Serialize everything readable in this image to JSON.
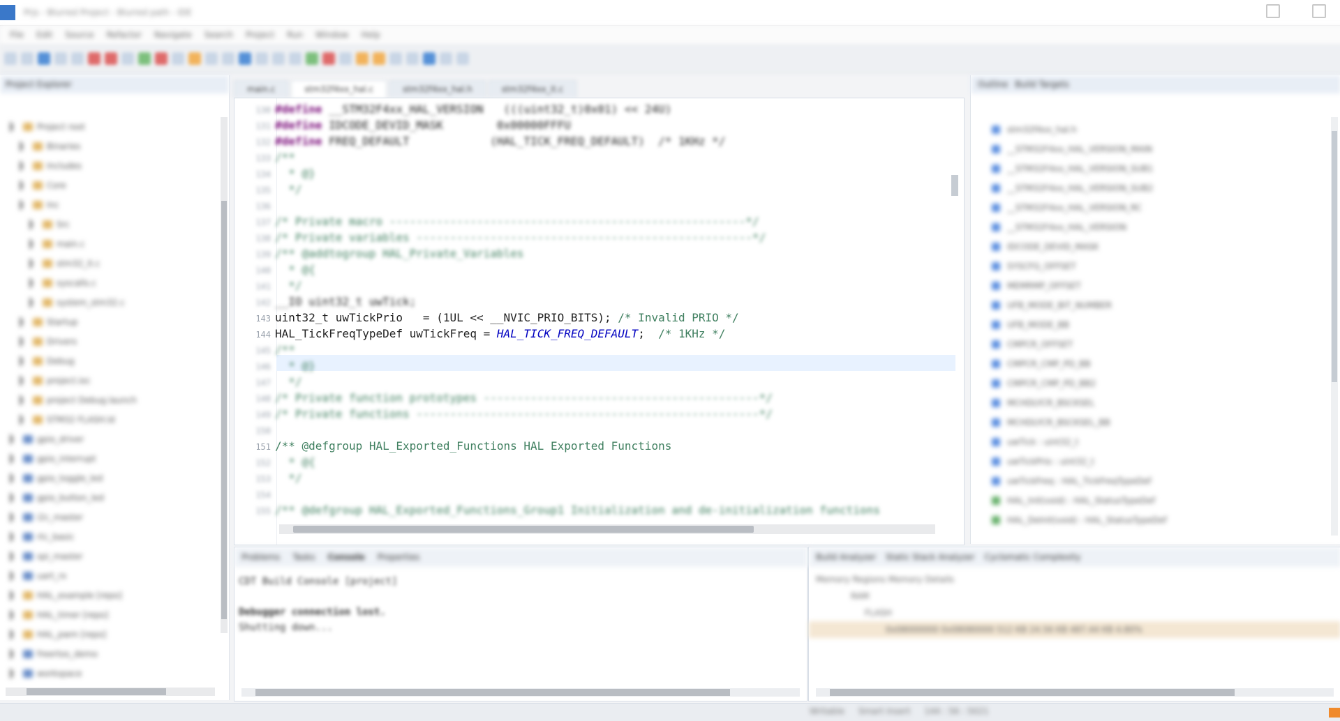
{
  "window": {
    "title": "Prjs - Blurred Project - Blurred path - IDE"
  },
  "menu": {
    "items": [
      "File",
      "Edit",
      "Source",
      "Refactor",
      "Navigate",
      "Search",
      "Project",
      "Run",
      "Window",
      "Help"
    ]
  },
  "left_panel": {
    "tab_label": "Project Explorer",
    "tree": [
      {
        "label": "Project root",
        "indent": 1,
        "icon": "folder"
      },
      {
        "label": "Binaries",
        "indent": 2,
        "icon": "folder"
      },
      {
        "label": "Includes",
        "indent": 2,
        "icon": "folder"
      },
      {
        "label": "Core",
        "indent": 2,
        "icon": "folder"
      },
      {
        "label": "Inc",
        "indent": 2,
        "icon": "folder"
      },
      {
        "label": "Src",
        "indent": 3,
        "icon": "file"
      },
      {
        "label": "main.c",
        "indent": 3,
        "icon": "file"
      },
      {
        "label": "stm32_it.c",
        "indent": 3,
        "icon": "file"
      },
      {
        "label": "syscalls.c",
        "indent": 3,
        "icon": "file"
      },
      {
        "label": "system_stm32.c",
        "indent": 3,
        "icon": "file"
      },
      {
        "label": "Startup",
        "indent": 2,
        "icon": "folder"
      },
      {
        "label": "Drivers",
        "indent": 2,
        "icon": "folder"
      },
      {
        "label": "Debug",
        "indent": 2,
        "icon": "folder"
      },
      {
        "label": "project.ioc",
        "indent": 2,
        "icon": "file"
      },
      {
        "label": "project Debug.launch",
        "indent": 2,
        "icon": "file"
      },
      {
        "label": "STM32 FLASH.ld",
        "indent": 2,
        "icon": "file"
      },
      {
        "label": "gpio_driver",
        "indent": 1,
        "icon": "folder-blue"
      },
      {
        "label": "gpio_interrupt",
        "indent": 1,
        "icon": "folder-blue"
      },
      {
        "label": "gpio_toggle_led",
        "indent": 1,
        "icon": "folder-blue"
      },
      {
        "label": "gpio_button_led",
        "indent": 1,
        "icon": "folder-blue"
      },
      {
        "label": "i2c_master",
        "indent": 1,
        "icon": "folder-blue"
      },
      {
        "label": "rtc_basic",
        "indent": 1,
        "icon": "folder-blue"
      },
      {
        "label": "spi_master",
        "indent": 1,
        "icon": "folder-blue"
      },
      {
        "label": "uart_rx",
        "indent": 1,
        "icon": "folder-blue"
      },
      {
        "label": "HAL_example [repo]",
        "indent": 1,
        "icon": "folder"
      },
      {
        "label": "HAL_timer [repo]",
        "indent": 1,
        "icon": "folder"
      },
      {
        "label": "HAL_pwm [repo]",
        "indent": 1,
        "icon": "folder"
      },
      {
        "label": "freertos_demo",
        "indent": 1,
        "icon": "folder-blue"
      },
      {
        "label": "workspace",
        "indent": 1,
        "icon": "folder-blue"
      }
    ]
  },
  "editor": {
    "tabs": [
      "main.c",
      "stm32f4xx_hal.c",
      "stm32f4xx_hal.h",
      "stm32f4xx_it.c"
    ],
    "active_tab": 1,
    "lines": [
      {
        "num": "130",
        "tokens": [
          {
            "t": "#define",
            "c": "kw"
          },
          {
            "t": " __STM32F4xx_HAL_VERSION   (((uint32_t)0x01) << 24U)",
            "c": "plain"
          }
        ]
      },
      {
        "num": "131",
        "tokens": [
          {
            "t": "#define",
            "c": "kw"
          },
          {
            "t": " IDCODE_DEVID_MASK        0x00000FFFU",
            "c": "plain"
          }
        ]
      },
      {
        "num": "132",
        "tokens": [
          {
            "t": "#define",
            "c": "kw"
          },
          {
            "t": " FREQ_DEFAULT            (HAL_TICK_FREQ_DEFAULT)  /* 1KHz */",
            "c": "plain"
          }
        ]
      },
      {
        "num": "133",
        "tokens": [
          {
            "t": "/**",
            "c": "cm"
          }
        ]
      },
      {
        "num": "134",
        "tokens": [
          {
            "t": "  * @}",
            "c": "cm"
          }
        ]
      },
      {
        "num": "135",
        "tokens": [
          {
            "t": "  */",
            "c": "cm"
          }
        ]
      },
      {
        "num": "136",
        "tokens": [
          {
            "t": "",
            "c": "plain"
          }
        ]
      },
      {
        "num": "137",
        "tokens": [
          {
            "t": "/* Private macro -----------------------------------------------------*/",
            "c": "cm"
          }
        ]
      },
      {
        "num": "138",
        "tokens": [
          {
            "t": "/* Private variables --------------------------------------------------*/",
            "c": "cm"
          }
        ]
      },
      {
        "num": "139",
        "tokens": [
          {
            "t": "/** @addtogroup HAL_Private_Variables",
            "c": "cm"
          }
        ]
      },
      {
        "num": "140",
        "tokens": [
          {
            "t": "  * @{",
            "c": "cm"
          }
        ]
      },
      {
        "num": "141",
        "tokens": [
          {
            "t": "  */",
            "c": "cm"
          }
        ]
      },
      {
        "num": "142",
        "tokens": [
          {
            "t": "__IO uint32_t uwTick;",
            "c": "plain"
          }
        ]
      },
      {
        "num": "143",
        "tokens": [
          {
            "t": "uint32_t uwTickPrio   = (1UL << __NVIC_PRIO_BITS); ",
            "c": "plain"
          },
          {
            "t": "/* Invalid PRIO */",
            "c": "cm"
          }
        ]
      },
      {
        "num": "144",
        "tokens": [
          {
            "t": "HAL_TickFreqTypeDef uwTickFreq = ",
            "c": "plain"
          },
          {
            "t": "HAL_TICK_FREQ_DEFAULT",
            "c": "it"
          },
          {
            "t": ";  ",
            "c": "plain"
          },
          {
            "t": "/* 1KHz */",
            "c": "cm"
          }
        ]
      },
      {
        "num": "145",
        "tokens": [
          {
            "t": "/**",
            "c": "cm"
          }
        ]
      },
      {
        "num": "146",
        "tokens": [
          {
            "t": "  * @}",
            "c": "cm"
          }
        ]
      },
      {
        "num": "147",
        "tokens": [
          {
            "t": "  */",
            "c": "cm"
          }
        ]
      },
      {
        "num": "148",
        "tokens": [
          {
            "t": "/* Private function prototypes -----------------------------------------*/",
            "c": "cm"
          }
        ]
      },
      {
        "num": "149",
        "tokens": [
          {
            "t": "/* Private functions ---------------------------------------------------*/",
            "c": "cm"
          }
        ]
      },
      {
        "num": "150",
        "tokens": [
          {
            "t": "",
            "c": "plain"
          }
        ]
      },
      {
        "num": "151",
        "tokens": [
          {
            "t": "/** @defgroup HAL_Exported_Functions HAL Exported Functions",
            "c": "cm"
          }
        ]
      },
      {
        "num": "152",
        "tokens": [
          {
            "t": "  * @{",
            "c": "cm"
          }
        ]
      },
      {
        "num": "153",
        "tokens": [
          {
            "t": "  */",
            "c": "cm"
          }
        ]
      },
      {
        "num": "154",
        "tokens": [
          {
            "t": "",
            "c": "plain"
          }
        ]
      },
      {
        "num": "155",
        "tokens": [
          {
            "t": "/** @defgroup HAL_Exported_Functions_Group1 Initialization and de-initialization functions",
            "c": "cm"
          }
        ]
      }
    ]
  },
  "right_panel": {
    "tab_label": "Outline",
    "tab2_label": "Build Targets",
    "items": [
      {
        "label": "stm32f4xx_hal.h",
        "icon": "blue"
      },
      {
        "label": "__STM32F4xx_HAL_VERSION_MAIN",
        "icon": "blue"
      },
      {
        "label": "__STM32F4xx_HAL_VERSION_SUB1",
        "icon": "blue"
      },
      {
        "label": "__STM32F4xx_HAL_VERSION_SUB2",
        "icon": "blue"
      },
      {
        "label": "__STM32F4xx_HAL_VERSION_RC",
        "icon": "blue"
      },
      {
        "label": "__STM32F4xx_HAL_VERSION",
        "icon": "blue"
      },
      {
        "label": "IDCODE_DEVID_MASK",
        "icon": "blue"
      },
      {
        "label": "SYSCFG_OFFSET",
        "icon": "blue"
      },
      {
        "label": "MEMRMP_OFFSET",
        "icon": "blue"
      },
      {
        "label": "UFB_MODE_BIT_NUMBER",
        "icon": "blue"
      },
      {
        "label": "UFB_MODE_BB",
        "icon": "blue"
      },
      {
        "label": "CMPCR_OFFSET",
        "icon": "blue"
      },
      {
        "label": "CMPCR_CMP_PD_BB",
        "icon": "blue"
      },
      {
        "label": "CMPCR_CMP_PD_BB2",
        "icon": "blue"
      },
      {
        "label": "MCHDLYCR_BSCKSEL",
        "icon": "blue"
      },
      {
        "label": "MCHDLYCR_BSCKSEL_BB",
        "icon": "blue"
      },
      {
        "label": "uwTick : uint32_t",
        "icon": "blue"
      },
      {
        "label": "uwTickPrio : uint32_t",
        "icon": "blue"
      },
      {
        "label": "uwTickFreq : HAL_TickFreqTypeDef",
        "icon": "blue"
      },
      {
        "label": "HAL_Init(void) : HAL_StatusTypeDef",
        "icon": "green"
      },
      {
        "label": "HAL_DeInit(void) : HAL_StatusTypeDef",
        "icon": "green"
      }
    ]
  },
  "bottom_left": {
    "tabs": [
      "Problems",
      "Tasks",
      "Console",
      "Properties"
    ],
    "active_tab": 2,
    "header_line": "CDT Build Console [project]",
    "lines": [
      "Debugger connection lost.",
      "Shutting down..."
    ]
  },
  "bottom_right": {
    "tabs": [
      "Build Analyzer",
      "Static Stack Analyzer",
      "Cyclomatic Complexity"
    ],
    "header_line": "Memory Regions  Memory Details",
    "lines": [
      "RAM",
      "FLASH",
      "0x08000000  0x08080000  512 KB  24.56 KB  487.44 KB  4.80%"
    ]
  },
  "status": {
    "items": [
      "Writable",
      "Smart Insert",
      "144 : 56 : 5021"
    ]
  },
  "colors": {
    "keyword": "#7a0b7a",
    "comment": "#3f7f5f",
    "italic_const": "#0000c0",
    "accent": "#3a78c9"
  }
}
